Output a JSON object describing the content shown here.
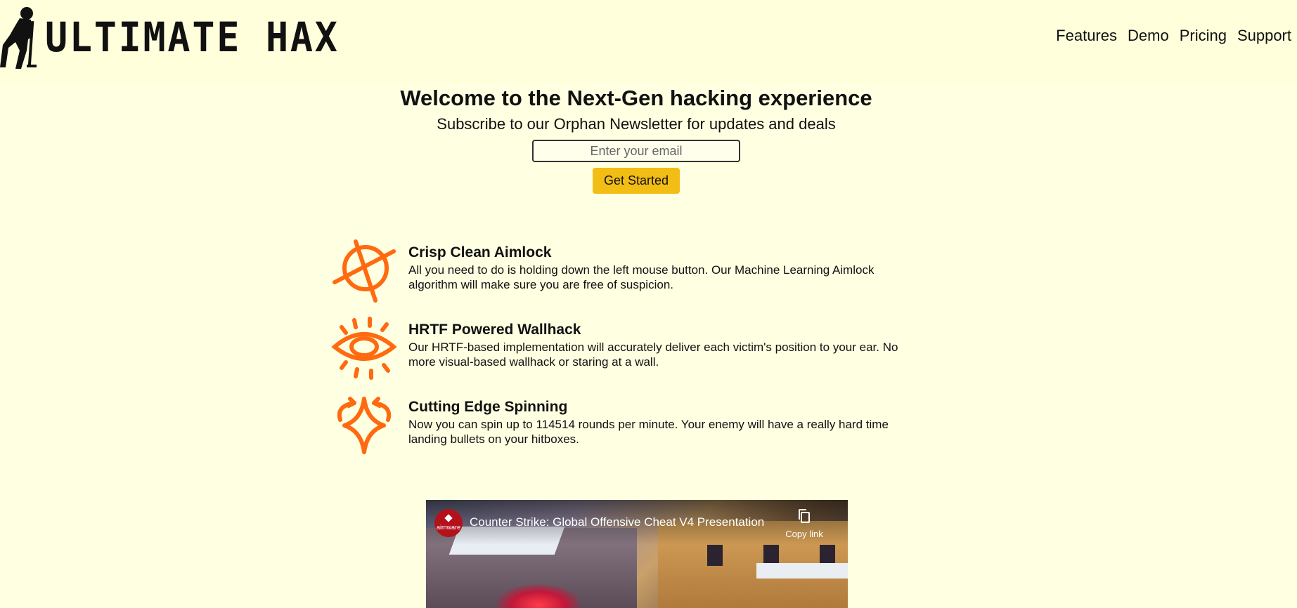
{
  "header": {
    "logo_text": "ULTIMATE HAX",
    "nav": [
      {
        "label": "Features"
      },
      {
        "label": "Demo"
      },
      {
        "label": "Pricing"
      },
      {
        "label": "Support"
      }
    ]
  },
  "hero": {
    "title": "Welcome to the Next-Gen hacking experience",
    "subtitle": "Subscribe to our Orphan Newsletter for updates and deals",
    "email_placeholder": "Enter your email",
    "cta_label": "Get Started"
  },
  "features": [
    {
      "icon": "crosshair-icon",
      "title": "Crisp Clean Aimlock",
      "description": "All you need to do is holding down the left mouse button. Our Machine Learning Aimlock algorithm will make sure you are free of suspicion."
    },
    {
      "icon": "eye-icon",
      "title": "HRTF Powered Wallhack",
      "description": "Our HRTF-based implementation will accurately deliver each victim's position to your ear. No more visual-based wallhack or staring at a wall."
    },
    {
      "icon": "spin-icon",
      "title": "Cutting Edge Spinning",
      "description": "Now you can spin up to 114514 rounds per minute. Your enemy will have a really hard time landing bullets on your hitboxes."
    }
  ],
  "video": {
    "channel_name": "aimware",
    "title": "Counter Strike: Global Offensive Cheat V4 Presentation",
    "copy_label": "Copy link"
  },
  "colors": {
    "background": "#ffffe2",
    "header_background": "#ffffdb",
    "accent_button": "#f2bd14",
    "icon_orange": "#ff6a10"
  }
}
